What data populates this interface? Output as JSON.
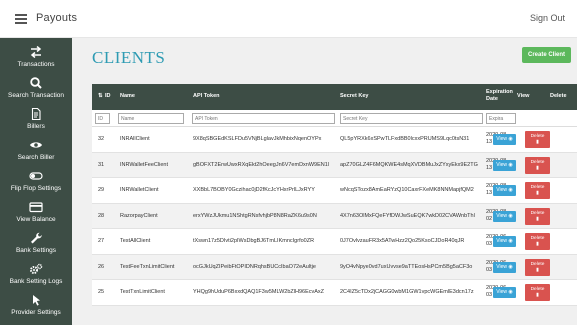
{
  "header": {
    "menu_icon": "hamburger-icon",
    "app_title": "Payouts",
    "signout_label": "Sign Out"
  },
  "sidebar": {
    "items": [
      {
        "label": "Transactions",
        "icon": "transfer-icon"
      },
      {
        "label": "Search Transaction",
        "icon": "search-icon"
      },
      {
        "label": "Billers",
        "icon": "document-icon"
      },
      {
        "label": "Search Biller",
        "icon": "eye-icon"
      },
      {
        "label": "Flip Flop Settings",
        "icon": "toggle-icon"
      },
      {
        "label": "View Balance",
        "icon": "credit-card-icon"
      },
      {
        "label": "Bank Settings",
        "icon": "wrench-icon"
      },
      {
        "label": "Bank Setting Logs",
        "icon": "gears-icon"
      },
      {
        "label": "Provider Settings",
        "icon": "pointer-icon"
      }
    ]
  },
  "main": {
    "title": "CLIENTS",
    "create_button": "Create Client",
    "columns": {
      "id": "ID",
      "name": "Name",
      "api_token": "API Token",
      "secret_key": "Secret Key",
      "expiration_date": "Expiration Date",
      "view": "View",
      "delete": "Delete"
    },
    "filters": {
      "id_placeholder": "ID",
      "name_placeholder": "Name",
      "token_placeholder": "API Token",
      "secret_placeholder": "Secret Key",
      "exp_placeholder": "Expira"
    },
    "view_label": "View",
    "delete_label": "Delete",
    "rows": [
      {
        "id": "32",
        "name": "INRAllClient",
        "token": "9X8qSBGEdKSLFDu5VNjBLglavJkMhbixNqenOYPx",
        "secret": "QL5pYRXk6xSPwTLFxdBB0lcxxPRUMS9Lqc0tsN31",
        "exp": "2020-08-13"
      },
      {
        "id": "31",
        "name": "INRWalletFeeClient",
        "token": "gBOFXT2ErwUwxRXqEkt2hOeegJn6V7emDxnW9EN1l",
        "secret": "apZ70GLZ4F6MQKWE4sMqXVDBMuJxZYxyEkx9E2TG",
        "exp": "2020-08-13"
      },
      {
        "id": "29",
        "name": "INRWalletClient",
        "token": "XXBbL7BOBY0Gczihac0jD2fKcJcYHxrPrlLJxRYY",
        "secret": "wNcqSTozx8AmEaRYzQ10CaxrFXeMK8NNMapjfQM2",
        "exp": "2020-08-13"
      },
      {
        "id": "28",
        "name": "RazorpayClient",
        "token": "erxYWzJUkmu1NShtgRNsfvhjbP8N8RaZK6u9s0N",
        "secret": "4X7n63OlMxFQeFYfDWJwSuEQK7wkD02CVAWnbThl",
        "exp": "2020-08-02"
      },
      {
        "id": "27",
        "name": "TestAllClient",
        "token": "tXswn17z5DIvti2pIWsDbgBJ6TmLIKmncIgrfo0ZR",
        "secret": "0J7OvlvzauFR3x5ATwHzz2Qo25KsoCJDoR40qJR",
        "exp": "2020-06-03"
      },
      {
        "id": "26",
        "name": "TestFeeTxnLimitClient",
        "token": "ocGJkUqZIPeibFtOPIDNRqhsBUCcIbaO72eAultje",
        "secret": "9yO4vNpye0vd7uxUvvse9aTTEosHsPCm5Bg5aCF3o",
        "exp": "2020-06-03"
      },
      {
        "id": "25",
        "name": "TestTxnLimitClient",
        "token": "YHQg9hUduP6BxxdQAQ1F3w5MLW2bZlH96EcvAxZ",
        "secret": "2C4IZ5cTDx2jCAGG0wbM1GW1vpcWGEmlE3dcn17z",
        "exp": "2020-06-03"
      }
    ]
  }
}
